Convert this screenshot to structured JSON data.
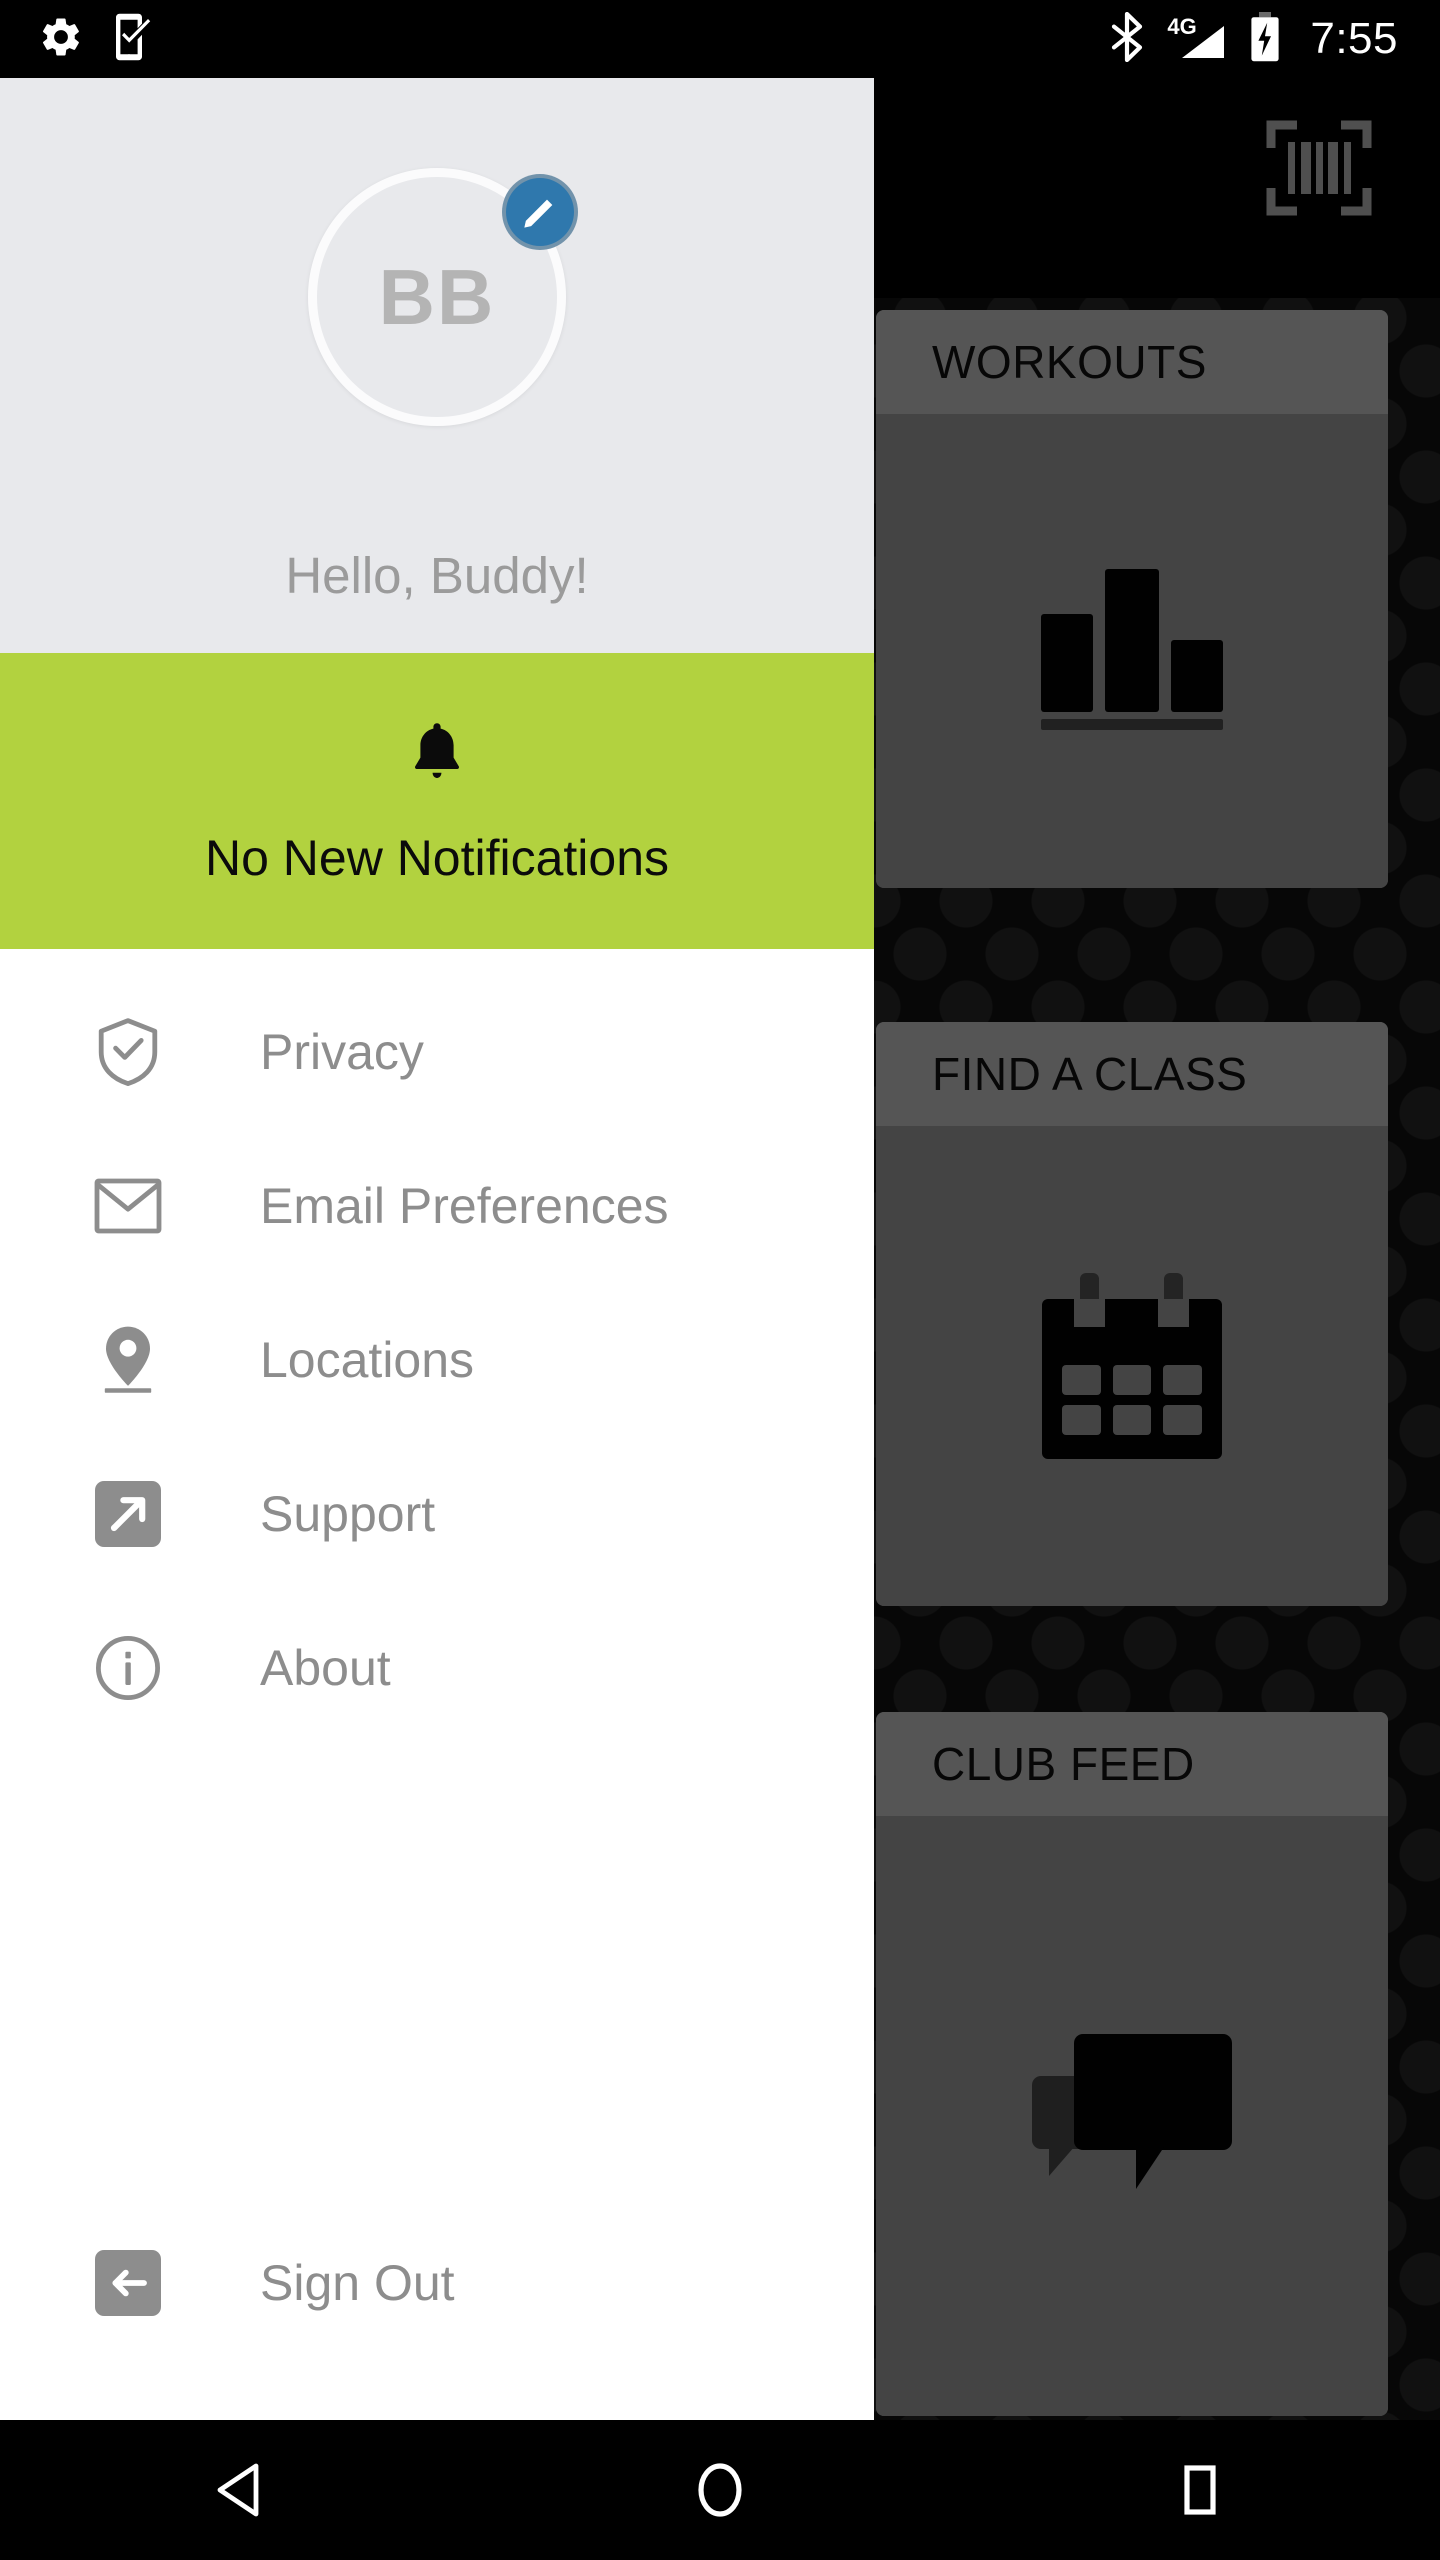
{
  "status_bar": {
    "left_icons": [
      {
        "name": "settings-gear-icon",
        "label": "Settings"
      },
      {
        "name": "phone-check-icon",
        "label": "Device check"
      }
    ],
    "right_icons": [
      {
        "name": "bluetooth-icon",
        "label": "Bluetooth"
      },
      {
        "name": "cellular-signal-icon",
        "label": "4G signal"
      },
      {
        "name": "battery-charging-icon",
        "label": "Battery charging"
      }
    ],
    "network_label": "4G",
    "clock": "7:55"
  },
  "drawer": {
    "avatar": {
      "initials": "BB",
      "edit_badge_icon": "pencil-edit-icon",
      "edit_badge_color": "#2f78ad"
    },
    "greeting": "Hello, Buddy!",
    "notification": {
      "icon": "bell-icon",
      "text": "No New Notifications",
      "background_color": "#b2d23f"
    },
    "menu_items": [
      {
        "icon": "shield-check-icon",
        "label": "Privacy"
      },
      {
        "icon": "envelope-icon",
        "label": "Email Preferences"
      },
      {
        "icon": "map-pin-icon",
        "label": "Locations"
      },
      {
        "icon": "external-link-icon",
        "label": "Support"
      },
      {
        "icon": "info-circle-icon",
        "label": "About"
      }
    ],
    "sign_out": {
      "icon": "sign-out-arrow-icon",
      "label": "Sign Out"
    }
  },
  "app": {
    "top_bar": {
      "scan_icon": "barcode-scan-icon"
    },
    "cards": [
      {
        "title": "WORKOUTS",
        "icon": "bar-chart-icon"
      },
      {
        "title": "FIND A CLASS",
        "icon": "calendar-icon"
      },
      {
        "title": "CLUB FEED",
        "icon": "chat-bubbles-icon"
      }
    ]
  },
  "nav_bar": {
    "buttons": [
      {
        "icon": "back-triangle-icon",
        "label": "Back"
      },
      {
        "icon": "home-circle-icon",
        "label": "Home"
      },
      {
        "icon": "recents-square-icon",
        "label": "Recents"
      }
    ]
  }
}
